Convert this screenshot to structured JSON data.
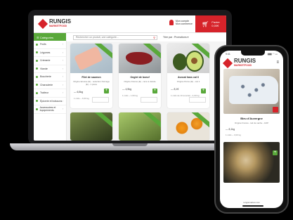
{
  "brand": {
    "name": "RUNGIS",
    "sub": "MARKETFOOD"
  },
  "header": {
    "account_line1": "Mon compte",
    "account_line2": "Mon commerce",
    "cart_line1": "Panier",
    "cart_line2": "0,00€"
  },
  "toolbar": {
    "categories_label": "☰ Catégories",
    "search_placeholder": "Rechercher un produit, une catégorie...",
    "sort_label": "Trier par : Promotions ▾"
  },
  "sidebar": {
    "items": [
      {
        "label": "Fruits"
      },
      {
        "label": "Légumes"
      },
      {
        "label": "Crèmerie"
      },
      {
        "label": "Viande"
      },
      {
        "label": "Boucherie"
      },
      {
        "label": "Charcuterie"
      },
      {
        "label": "Traiteur"
      },
      {
        "label": "Épicerie et boissons"
      },
      {
        "label": "Accessoires et équipements"
      }
    ]
  },
  "products": [
    {
      "name": "Filet de saumon",
      "desc": "Origine Ecosse (E) - selection Norvège (E) - 1 pièce",
      "price": "— 6,5kg",
      "unit": "1 colis ~ 6,50 kg",
      "image": "fish"
    },
    {
      "name": "Onglet de boeuf",
      "desc": "Origine France (E) - race à viande",
      "price": "— 4,5kg",
      "unit": "1 colis ~ 1,50 kg",
      "image": "beef"
    },
    {
      "name": "Avocat hass cal 6",
      "desc": "Origine Pérou (E) - cat 1",
      "price": "— 8,1€",
      "unit": "1 colis de 10 avocats - 4,00 kg",
      "image": "avocado"
    }
  ],
  "products_row2": [
    {
      "image": "artichoke"
    },
    {
      "image": "greens"
    },
    {
      "image": "orange"
    }
  ],
  "mobile": {
    "status_time": "9:41",
    "status_icons": "▮▮▮ ◠ ▭",
    "menu_icon": "≡",
    "product_name": "Bleu d'Auvergne",
    "product_desc": "Origine France - lait de vache - AOP",
    "product_price": "— 8,1kg",
    "product_unit": "1 colis ~ 3,00 kg",
    "url": "rungismarket.com"
  },
  "colors": {
    "brand_red": "#d6232a",
    "brand_green": "#59a83a"
  }
}
